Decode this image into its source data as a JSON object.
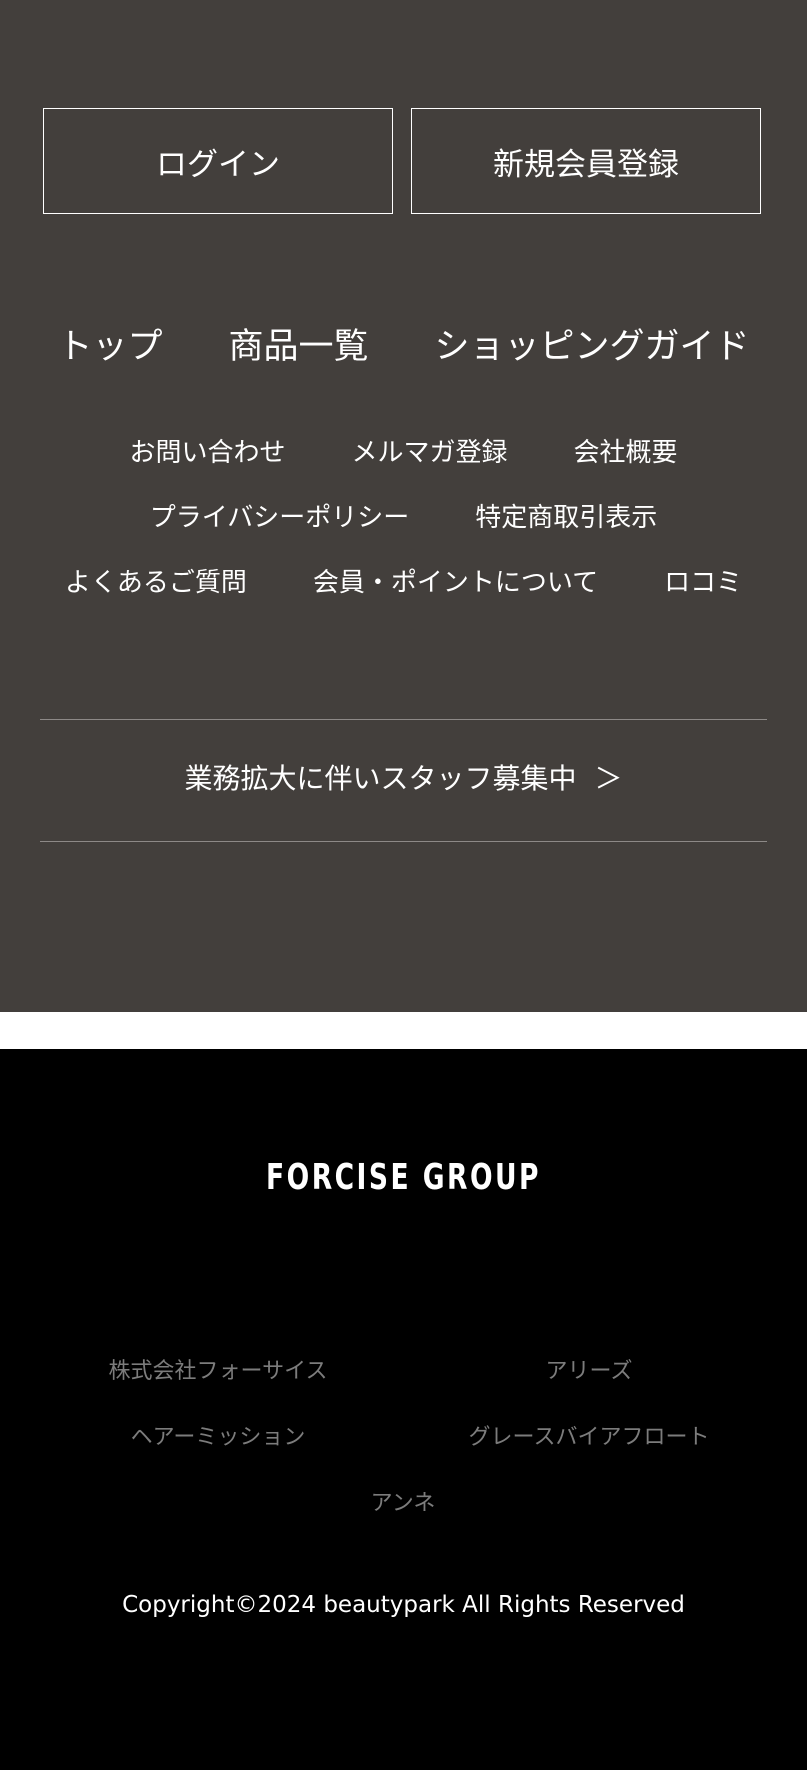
{
  "auth": {
    "login_label": "ログイン",
    "register_label": "新規会員登録"
  },
  "nav_main": {
    "items": [
      "トップ",
      "商品一覧",
      "ショッピングガイド"
    ]
  },
  "nav_sub": {
    "row1": [
      "お問い合わせ",
      "メルマガ登録",
      "会社概要"
    ],
    "row2": [
      "プライバシーポリシー",
      "特定商取引表示"
    ],
    "row3": [
      "よくあるご質問",
      "会員・ポイントについて",
      "ロコミ"
    ]
  },
  "recruit": {
    "label": "業務拡大に伴いスタッフ募集中",
    "arrow": "＞"
  },
  "group": {
    "logo_text": "FORCISE GROUP",
    "companies": [
      "株式会社フォーサイス",
      "アリーズ",
      "ヘアーミッション",
      "グレースバイアフロート",
      "アンネ"
    ]
  },
  "copyright": "Copyright©2024 beautypark All Rights Reserved",
  "colors": {
    "top_bg": "#433f3c",
    "bottom_bg": "#000000",
    "gap_bg": "#ffffff",
    "muted_text": "#7c7c7c"
  }
}
